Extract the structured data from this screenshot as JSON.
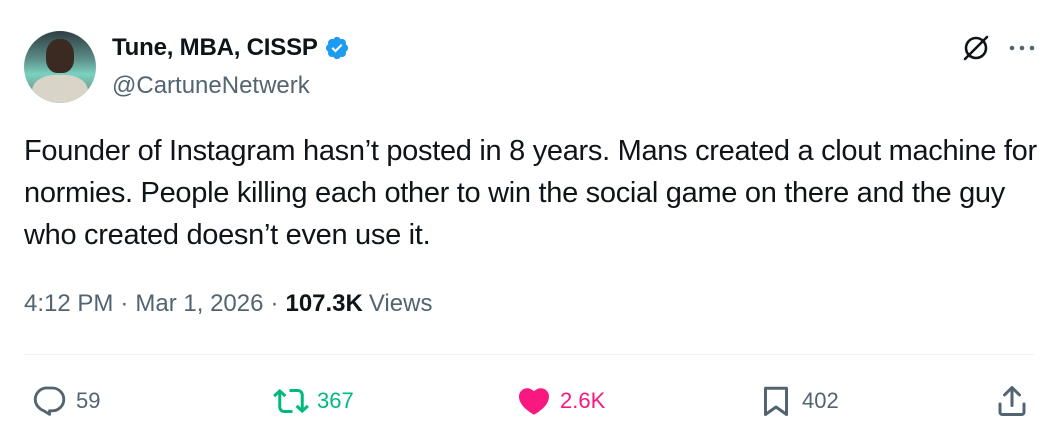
{
  "author": {
    "display_name": "Tune, MBA, CISSP",
    "handle": "@CartuneNetwerk",
    "verified": true,
    "verified_color": "#1d9bf0"
  },
  "tweet": {
    "text": "Founder of Instagram hasn’t posted in 8 years. Mans created a clout machine for normies. People killing each other to win the social game on there and the guy who created doesn’t even use it.",
    "time": "4:12 PM",
    "separator": "·",
    "date": "Mar 1, 2026",
    "views_count": "107.3K",
    "views_label": "Views"
  },
  "actions": {
    "replies": "59",
    "retweets": "367",
    "likes": "2.6K",
    "bookmarks": "402"
  },
  "icons": {
    "header": [
      "grok-icon",
      "more-icon"
    ],
    "actions": [
      "reply-icon",
      "retweet-icon",
      "like-icon",
      "bookmark-icon",
      "share-icon"
    ]
  },
  "colors": {
    "text_primary": "#0f1419",
    "text_secondary": "#536471",
    "retweet_green": "#00ba7c",
    "like_pink": "#f91880",
    "divider": "#eff3f4"
  }
}
